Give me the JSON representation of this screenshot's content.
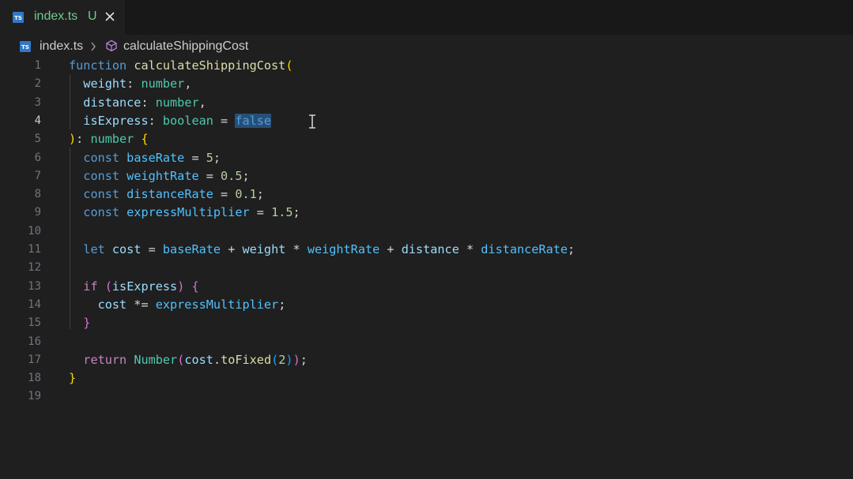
{
  "tab": {
    "filename": "index.ts",
    "status": "U"
  },
  "breadcrumb": {
    "file": "index.ts",
    "symbol": "calculateShippingCost"
  },
  "editor": {
    "active_line": 4,
    "lines": [
      {
        "n": "1",
        "tokens": [
          [
            "kw",
            "function"
          ],
          [
            "op",
            " "
          ],
          [
            "fn",
            "calculateShippingCost"
          ],
          [
            "b1",
            "("
          ]
        ]
      },
      {
        "n": "2",
        "tokens": [
          [
            "op",
            "  "
          ],
          [
            "var",
            "weight"
          ],
          [
            "op",
            ": "
          ],
          [
            "typ",
            "number"
          ],
          [
            "op",
            ","
          ]
        ]
      },
      {
        "n": "3",
        "tokens": [
          [
            "op",
            "  "
          ],
          [
            "var",
            "distance"
          ],
          [
            "op",
            ": "
          ],
          [
            "typ",
            "number"
          ],
          [
            "op",
            ","
          ]
        ]
      },
      {
        "n": "4",
        "tokens": [
          [
            "op",
            "  "
          ],
          [
            "var",
            "isExpress"
          ],
          [
            "op",
            ": "
          ],
          [
            "typ",
            "boolean"
          ],
          [
            "op",
            " = "
          ],
          [
            "kw sel",
            "false"
          ]
        ]
      },
      {
        "n": "5",
        "tokens": [
          [
            "b1",
            ")"
          ],
          [
            "op",
            ": "
          ],
          [
            "typ",
            "number"
          ],
          [
            "op",
            " "
          ],
          [
            "b1",
            "{"
          ]
        ]
      },
      {
        "n": "6",
        "tokens": [
          [
            "op",
            "  "
          ],
          [
            "kw",
            "const"
          ],
          [
            "op",
            " "
          ],
          [
            "cst",
            "baseRate"
          ],
          [
            "op",
            " = "
          ],
          [
            "num",
            "5"
          ],
          [
            "op",
            ";"
          ]
        ]
      },
      {
        "n": "7",
        "tokens": [
          [
            "op",
            "  "
          ],
          [
            "kw",
            "const"
          ],
          [
            "op",
            " "
          ],
          [
            "cst",
            "weightRate"
          ],
          [
            "op",
            " = "
          ],
          [
            "num",
            "0.5"
          ],
          [
            "op",
            ";"
          ]
        ]
      },
      {
        "n": "8",
        "tokens": [
          [
            "op",
            "  "
          ],
          [
            "kw",
            "const"
          ],
          [
            "op",
            " "
          ],
          [
            "cst",
            "distanceRate"
          ],
          [
            "op",
            " = "
          ],
          [
            "num",
            "0.1"
          ],
          [
            "op",
            ";"
          ]
        ]
      },
      {
        "n": "9",
        "tokens": [
          [
            "op",
            "  "
          ],
          [
            "kw",
            "const"
          ],
          [
            "op",
            " "
          ],
          [
            "cst",
            "expressMultiplier"
          ],
          [
            "op",
            " = "
          ],
          [
            "num",
            "1.5"
          ],
          [
            "op",
            ";"
          ]
        ]
      },
      {
        "n": "10",
        "tokens": []
      },
      {
        "n": "11",
        "tokens": [
          [
            "op",
            "  "
          ],
          [
            "kw",
            "let"
          ],
          [
            "op",
            " "
          ],
          [
            "var",
            "cost"
          ],
          [
            "op",
            " = "
          ],
          [
            "cst",
            "baseRate"
          ],
          [
            "op",
            " + "
          ],
          [
            "var",
            "weight"
          ],
          [
            "op",
            " * "
          ],
          [
            "cst",
            "weightRate"
          ],
          [
            "op",
            " + "
          ],
          [
            "var",
            "distance"
          ],
          [
            "op",
            " * "
          ],
          [
            "cst",
            "distanceRate"
          ],
          [
            "op",
            ";"
          ]
        ]
      },
      {
        "n": "12",
        "tokens": []
      },
      {
        "n": "13",
        "tokens": [
          [
            "op",
            "  "
          ],
          [
            "ctl",
            "if"
          ],
          [
            "op",
            " "
          ],
          [
            "b2",
            "("
          ],
          [
            "var",
            "isExpress"
          ],
          [
            "b2",
            ")"
          ],
          [
            "op",
            " "
          ],
          [
            "b2",
            "{"
          ]
        ]
      },
      {
        "n": "14",
        "tokens": [
          [
            "op",
            "    "
          ],
          [
            "var",
            "cost"
          ],
          [
            "op",
            " *= "
          ],
          [
            "cst",
            "expressMultiplier"
          ],
          [
            "op",
            ";"
          ]
        ]
      },
      {
        "n": "15",
        "tokens": [
          [
            "op",
            "  "
          ],
          [
            "b2",
            "}"
          ]
        ]
      },
      {
        "n": "16",
        "tokens": []
      },
      {
        "n": "17",
        "tokens": [
          [
            "op",
            "  "
          ],
          [
            "ctl",
            "return"
          ],
          [
            "op",
            " "
          ],
          [
            "typ",
            "Number"
          ],
          [
            "b2",
            "("
          ],
          [
            "var",
            "cost"
          ],
          [
            "op",
            "."
          ],
          [
            "fn",
            "toFixed"
          ],
          [
            "b3",
            "("
          ],
          [
            "num",
            "2"
          ],
          [
            "b3",
            ")"
          ],
          [
            "b2",
            ")"
          ],
          [
            "op",
            ";"
          ]
        ]
      },
      {
        "n": "18",
        "tokens": [
          [
            "b1",
            "}"
          ]
        ]
      },
      {
        "n": "19",
        "tokens": []
      }
    ]
  },
  "colors": {
    "keyword": "#569cd6",
    "function": "#dcdcaa",
    "variable": "#9cdcfe",
    "constant": "#4fc1ff",
    "type": "#4ec9b0",
    "number": "#b5cea8",
    "control": "#c586c0",
    "untracked": "#73c991"
  }
}
